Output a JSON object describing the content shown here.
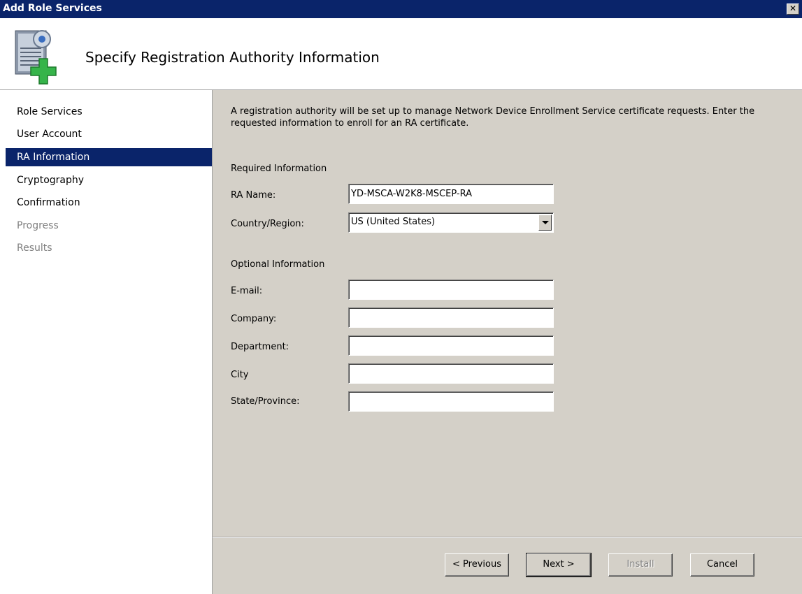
{
  "window": {
    "title": "Add Role Services",
    "close_glyph": "✕"
  },
  "header": {
    "title": "Specify Registration Authority Information",
    "icon": "server-add-icon"
  },
  "nav": {
    "items": [
      {
        "label": "Role Services",
        "state": "normal"
      },
      {
        "label": "User Account",
        "state": "normal"
      },
      {
        "label": "RA Information",
        "state": "selected"
      },
      {
        "label": "Cryptography",
        "state": "normal"
      },
      {
        "label": "Confirmation",
        "state": "normal"
      },
      {
        "label": "Progress",
        "state": "disabled"
      },
      {
        "label": "Results",
        "state": "disabled"
      }
    ]
  },
  "content": {
    "description": "A registration authority will be set up to manage Network Device Enrollment Service certificate requests. Enter the requested information to enroll for an RA certificate.",
    "required_heading": "Required Information",
    "ra_name": {
      "label": "RA Name:",
      "value": "YD-MSCA-W2K8-MSCEP-RA"
    },
    "country": {
      "label": "Country/Region:",
      "value": "US (United States)"
    },
    "optional_heading": "Optional Information",
    "email": {
      "label": "E-mail:",
      "value": ""
    },
    "company": {
      "label": "Company:",
      "value": ""
    },
    "department": {
      "label": "Department:",
      "value": ""
    },
    "city": {
      "label": "City",
      "value": ""
    },
    "state": {
      "label": "State/Province:",
      "value": ""
    }
  },
  "buttons": {
    "previous": "< Previous",
    "next": "Next >",
    "install": "Install",
    "cancel": "Cancel"
  },
  "colors": {
    "titlebar": "#0a246a",
    "dialog_face": "#d4d0c8",
    "selection": "#0a246a"
  }
}
